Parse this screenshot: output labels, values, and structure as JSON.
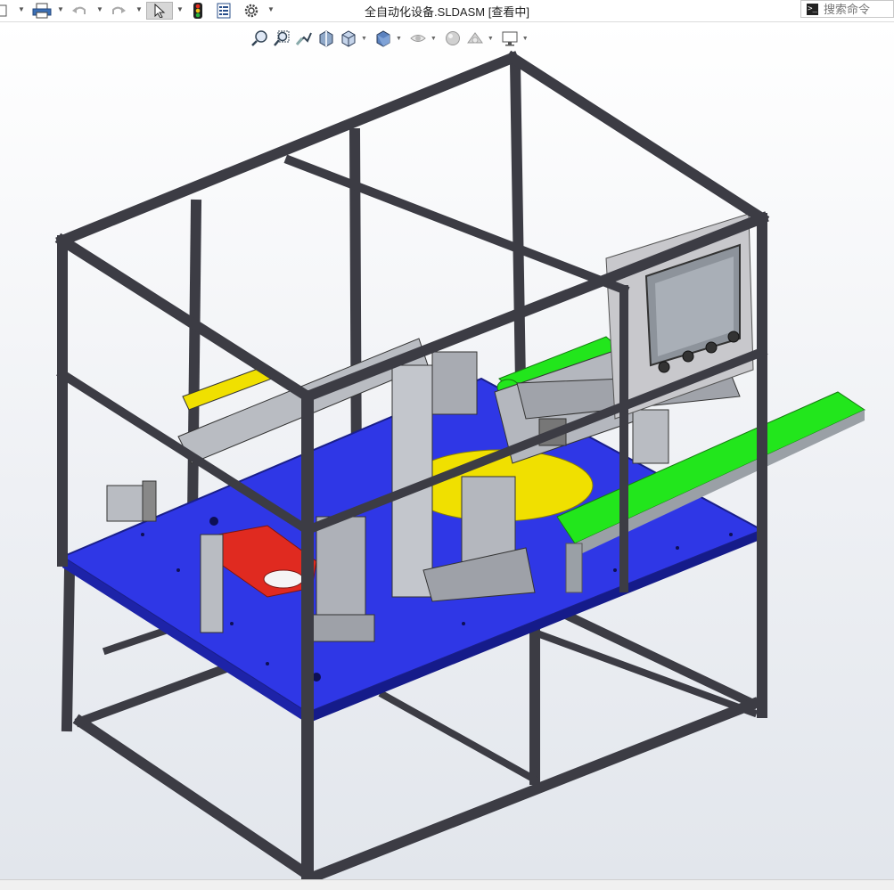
{
  "window": {
    "title": "全自动化设备.SLDASM [查看中]"
  },
  "toolbar": {
    "items": [
      "new",
      "print",
      "undo",
      "redo",
      "select",
      "rebuild",
      "file-properties",
      "options"
    ]
  },
  "search": {
    "placeholder": "搜索命令"
  },
  "heads_up_toolbar": {
    "items": [
      "zoom-to-fit",
      "zoom-to-area",
      "previous-view",
      "section-view",
      "view-orientation",
      "display-style",
      "hide-show-items",
      "edit-appearance",
      "apply-scene",
      "view-settings"
    ]
  },
  "colors": {
    "frame": "#3c3c44",
    "plate": "#2f37e6",
    "plate_edge": "#1a1f8a",
    "conveyor_belt": "#22e61c",
    "rotary_table": "#f0e000",
    "fixture_red": "#e02a20",
    "panel": "#c8c8cc"
  }
}
